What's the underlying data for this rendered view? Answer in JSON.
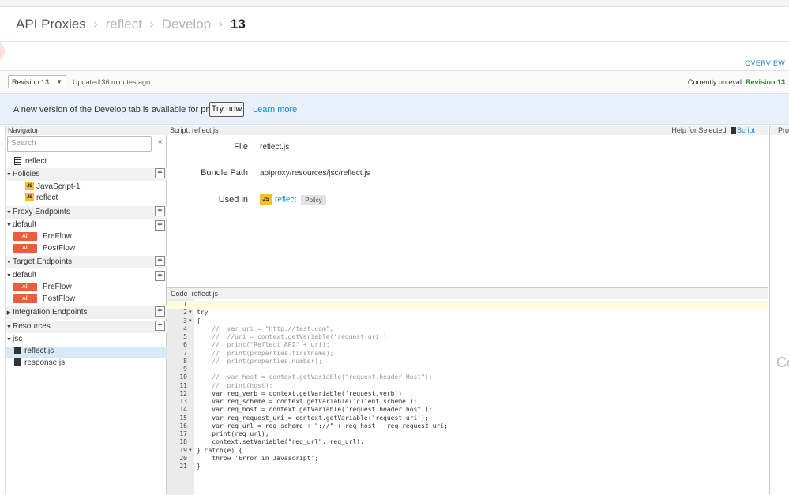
{
  "breadcrumb": [
    "API Proxies",
    "reflect",
    "Develop",
    "13"
  ],
  "overview_label": "OVERVIEW",
  "revision": {
    "selected": "Revision 13",
    "updated": "Updated 36 minutes ago",
    "eval_label": "Currently on eval:",
    "eval_value": "Revision 13"
  },
  "preview": {
    "message": "A new version of the Develop tab is available for preview",
    "try_label": "Try now",
    "learn_label": "Learn more"
  },
  "navigator": {
    "header": "Navigator",
    "search_placeholder": "Search",
    "collapse": "«",
    "proxy_name": "reflect",
    "policies_label": "Policies",
    "policies": [
      "JavaScript-1",
      "reflect"
    ],
    "proxy_endpoints_label": "Proxy Endpoints",
    "proxy_default": "default",
    "target_endpoints_label": "Target Endpoints",
    "target_default": "default",
    "all_badge": "All",
    "preflow": "PreFlow",
    "postflow": "PostFlow",
    "integration_label": "Integration Endpoints",
    "resources_label": "Resources",
    "jsc_folder": "jsc",
    "files": [
      "reflect.js",
      "response.js"
    ]
  },
  "script_panel": {
    "header": "Script: reflect.js",
    "help_label": "Help for Selected",
    "help_link": "Script",
    "file_label": "File",
    "file_value": "reflect.js",
    "bundle_label": "Bundle Path",
    "bundle_value": "apiproxy/resources/jsc/reflect.js",
    "used_label": "Used in",
    "used_link": "reflect",
    "used_badge": "Policy",
    "js_icon": "JS"
  },
  "code_panel": {
    "header": "Code",
    "file": "reflect.js",
    "lines": [
      "",
      "try",
      "{",
      "    //  var uri = \"http://test.com\";",
      "    //  //uri = context.getVariable('request.uri');",
      "    //  print(\"Reflect API\" + uri);",
      "    //  print(properties.firstname);",
      "    //  print(properties.number);",
      "    ",
      "    //  var host = context.getVariable(\"request.header.Host\");",
      "    //  print(host);",
      "    var req_verb = context.getVariable('request.verb');",
      "    var req_scheme = context.getVariable('client.scheme');",
      "    var req_host = context.getVariable('request.header.host');",
      "    var req_request_uri = context.getVariable('request.uri');",
      "    var req_url = req_scheme + \"://\" + req_host + req_request_uri;",
      "    print(req_url);",
      "    context.setVariable(\"req_url\", req_url);",
      "} catch(e) {",
      "    throw 'Error in Javascript';",
      "}"
    ]
  },
  "right_panel": {
    "header": "Pro",
    "body": "Co"
  }
}
